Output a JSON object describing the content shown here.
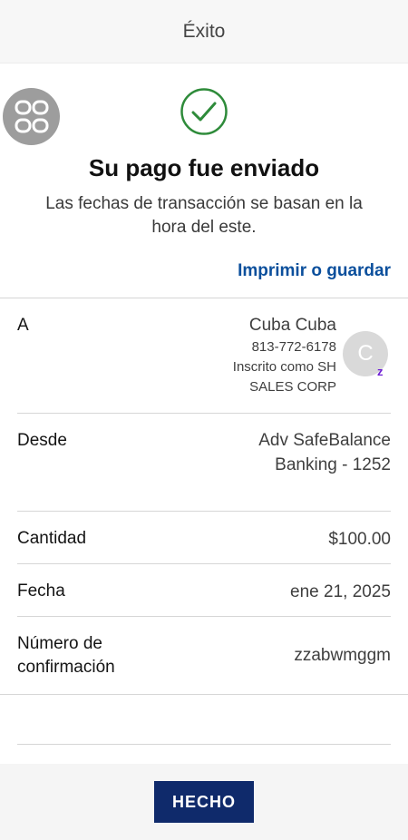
{
  "header": {
    "title": "Éxito"
  },
  "hero": {
    "headline": "Su pago fue enviado",
    "subtext": "Las fechas de transacción se basan en la hora del este.",
    "print_link": "Imprimir o guardar"
  },
  "details": {
    "to": {
      "label": "A",
      "name": "Cuba Cuba",
      "phone": "813-772-6178",
      "enrolled_line1": "Inscrito como SH",
      "enrolled_line2": "SALES CORP",
      "avatar_initial": "C",
      "badge": "z"
    },
    "from": {
      "label": "Desde",
      "line1": "Adv SafeBalance",
      "line2": "Banking - 1252"
    },
    "amount": {
      "label": "Cantidad",
      "value": "$100.00"
    },
    "date": {
      "label": "Fecha",
      "value": "ene 21, 2025"
    },
    "confirmation": {
      "label_line1": "Número de",
      "label_line2": "confirmación",
      "value": "zzabwmggm"
    }
  },
  "footer": {
    "done_label": "HECHO"
  },
  "icons": {
    "success": "check-circle-icon",
    "menu": "grid-menu-icon"
  },
  "colors": {
    "accent_green": "#2e8b3a",
    "link_blue": "#0b4f9c",
    "button_navy": "#0f2a6b",
    "zelle_purple": "#6d1ed4"
  }
}
